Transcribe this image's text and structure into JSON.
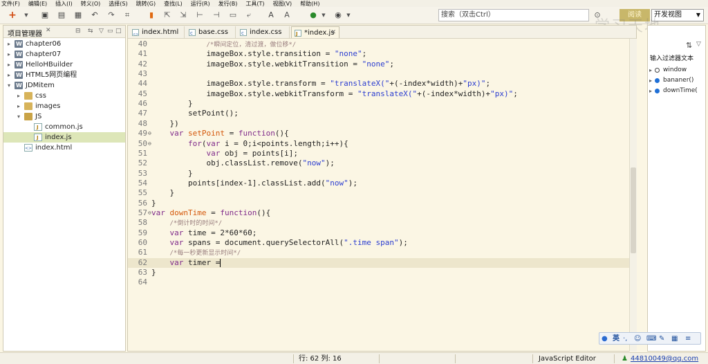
{
  "menu": [
    "文件(F)",
    "编辑(E)",
    "插入(I)",
    "转义(O)",
    "选择(S)",
    "跳转(G)",
    "查找(L)",
    "运行(R)",
    "发行(B)",
    "工具(T)",
    "视图(V)",
    "帮助(H)"
  ],
  "search": {
    "placeholder": "搜索（双击Ctrl）"
  },
  "toolbar": {
    "preview_label": "阅读",
    "perspective_label": "开发视图"
  },
  "watermark": "学习天地",
  "explorer": {
    "title": "项目管理器",
    "items": [
      {
        "label": "chapter06",
        "type": "project",
        "level": 0,
        "expanded": false
      },
      {
        "label": "chapter07",
        "type": "project",
        "level": 0,
        "expanded": false
      },
      {
        "label": "HelloHBuilder",
        "type": "project",
        "level": 0,
        "expanded": false
      },
      {
        "label": "HTML5网页编程",
        "type": "project",
        "level": 0,
        "expanded": false
      },
      {
        "label": "JDMitem",
        "type": "project",
        "level": 0,
        "expanded": true
      },
      {
        "label": "css",
        "type": "folder",
        "level": 1,
        "expanded": false
      },
      {
        "label": "images",
        "type": "folder",
        "level": 1,
        "expanded": false
      },
      {
        "label": "JS",
        "type": "folder",
        "level": 1,
        "expanded": true
      },
      {
        "label": "common.js",
        "type": "js",
        "level": 2
      },
      {
        "label": "index.js",
        "type": "js",
        "level": 2,
        "selected": true
      },
      {
        "label": "index.html",
        "type": "html",
        "level": 1
      }
    ]
  },
  "editor": {
    "tabs": [
      {
        "label": "index.html",
        "kind": "html"
      },
      {
        "label": "base.css",
        "kind": "css"
      },
      {
        "label": "index.css",
        "kind": "css"
      },
      {
        "label": "*index.js",
        "kind": "js",
        "active": true
      }
    ],
    "current_line": 62,
    "lines": [
      {
        "n": 40,
        "segs": [
          [
            "            ",
            ""
          ],
          [
            "/*瞬间定位，清过渡，做位移*/",
            "c"
          ]
        ]
      },
      {
        "n": 41,
        "segs": [
          [
            "            imageBox.style.transition = ",
            ""
          ],
          [
            "\"none\"",
            "s"
          ],
          [
            ";",
            ""
          ]
        ]
      },
      {
        "n": 42,
        "segs": [
          [
            "            imageBox.style.webkitTransition = ",
            ""
          ],
          [
            "\"none\"",
            "s"
          ],
          [
            ";",
            ""
          ]
        ]
      },
      {
        "n": 43,
        "segs": [
          [
            "",
            ""
          ]
        ]
      },
      {
        "n": 44,
        "segs": [
          [
            "            imageBox.style.transform = ",
            ""
          ],
          [
            "\"translateX(\"",
            "s"
          ],
          [
            "+(-index*width)+",
            ""
          ],
          [
            "\"px)\"",
            "s"
          ],
          [
            ";",
            ""
          ]
        ]
      },
      {
        "n": 45,
        "segs": [
          [
            "            imageBox.style.webkitTransform = ",
            ""
          ],
          [
            "\"translateX(\"",
            "s"
          ],
          [
            "+(-index*width)+",
            ""
          ],
          [
            "\"px)\"",
            "s"
          ],
          [
            ";",
            ""
          ]
        ]
      },
      {
        "n": 46,
        "segs": [
          [
            "        }",
            ""
          ]
        ]
      },
      {
        "n": 47,
        "segs": [
          [
            "        setPoint();",
            ""
          ]
        ]
      },
      {
        "n": 48,
        "segs": [
          [
            "    })",
            ""
          ]
        ]
      },
      {
        "n": 49,
        "fold": true,
        "segs": [
          [
            "    ",
            ""
          ],
          [
            "var",
            "k"
          ],
          [
            " ",
            ""
          ],
          [
            "setPoint",
            "f"
          ],
          [
            " = ",
            ""
          ],
          [
            "function",
            "k"
          ],
          [
            "(){",
            ""
          ]
        ]
      },
      {
        "n": 50,
        "fold": true,
        "segs": [
          [
            "        ",
            ""
          ],
          [
            "for",
            "k"
          ],
          [
            "(",
            ""
          ],
          [
            "var",
            "k"
          ],
          [
            " i = 0;i<points.length;i++){",
            ""
          ]
        ]
      },
      {
        "n": 51,
        "segs": [
          [
            "            ",
            ""
          ],
          [
            "var",
            "k"
          ],
          [
            " obj = points[i];",
            ""
          ]
        ]
      },
      {
        "n": 52,
        "segs": [
          [
            "            obj.classList.remove(",
            ""
          ],
          [
            "\"now\"",
            "s"
          ],
          [
            ");",
            ""
          ]
        ]
      },
      {
        "n": 53,
        "segs": [
          [
            "        }",
            ""
          ]
        ]
      },
      {
        "n": 54,
        "segs": [
          [
            "        points[index-1].classList.add(",
            ""
          ],
          [
            "\"now\"",
            "s"
          ],
          [
            ");",
            ""
          ]
        ]
      },
      {
        "n": 55,
        "segs": [
          [
            "    }",
            ""
          ]
        ]
      },
      {
        "n": 56,
        "segs": [
          [
            "}",
            ""
          ]
        ]
      },
      {
        "n": 57,
        "fold": true,
        "segs": [
          [
            "var",
            "k"
          ],
          [
            " ",
            ""
          ],
          [
            "downTime",
            "f"
          ],
          [
            " = ",
            ""
          ],
          [
            "function",
            "k"
          ],
          [
            "(){",
            ""
          ]
        ]
      },
      {
        "n": 58,
        "segs": [
          [
            "    ",
            ""
          ],
          [
            "/*倒计时的时间*/",
            "c"
          ]
        ]
      },
      {
        "n": 59,
        "segs": [
          [
            "    ",
            ""
          ],
          [
            "var",
            "k"
          ],
          [
            " time = 2*60*60;",
            ""
          ]
        ]
      },
      {
        "n": 60,
        "segs": [
          [
            "    ",
            ""
          ],
          [
            "var",
            "k"
          ],
          [
            " spans = document.querySelectorAll(",
            ""
          ],
          [
            "\".time span\"",
            "s"
          ],
          [
            ");",
            ""
          ]
        ]
      },
      {
        "n": 61,
        "segs": [
          [
            "    ",
            ""
          ],
          [
            "/*每一秒更新显示时间*/",
            "c"
          ]
        ]
      },
      {
        "n": 62,
        "segs": [
          [
            "    ",
            ""
          ],
          [
            "var",
            "k"
          ],
          [
            " timer =",
            ""
          ]
        ],
        "cursor": true
      },
      {
        "n": 63,
        "segs": [
          [
            "}",
            ""
          ]
        ]
      },
      {
        "n": 64,
        "segs": [
          [
            "",
            ""
          ]
        ]
      }
    ]
  },
  "outline": {
    "filter_placeholder": "输入过滤器文本",
    "items": [
      {
        "label": "window",
        "marker": "hollow"
      },
      {
        "label": "bananer()",
        "marker": "blue"
      },
      {
        "label": "downTime(",
        "marker": "blue"
      }
    ]
  },
  "ime": {
    "lang": "英"
  },
  "status": {
    "position": "行: 62 列: 16",
    "editor_type": "JavaScript Editor",
    "user": "44810049@qq.com"
  }
}
